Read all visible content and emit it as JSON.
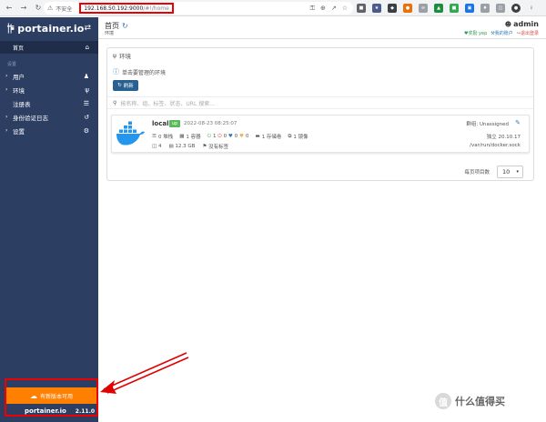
{
  "browser": {
    "security": "不安全",
    "url_host": "192.168.50.192:9000",
    "url_path": "/#!/home"
  },
  "sidebar": {
    "logo": "portainer.io",
    "home": "首页",
    "section": "设置",
    "items": [
      {
        "label": "用户",
        "icon": "users-icon"
      },
      {
        "label": "环境",
        "icon": "plug-icon"
      },
      {
        "label": "注册表",
        "icon": "database-icon"
      },
      {
        "label": "身份验证日志",
        "icon": "history-icon"
      },
      {
        "label": "设置",
        "icon": "cogs-icon"
      }
    ],
    "update_banner": "有新版本可用",
    "footer_logo": "portainer.io",
    "version": "2.11.0"
  },
  "header": {
    "title": "首页",
    "crumb": "环境",
    "user": "admin",
    "links": {
      "reward": "奖励 yep",
      "account": "我的账户",
      "logout": "退出登录"
    }
  },
  "panel": {
    "title": "环境",
    "info": "单击要管理的环境",
    "refresh": "刷新",
    "search_placeholder": "按名称、组、标签、状态、URL 搜索..."
  },
  "environment": {
    "name": "local",
    "status": "up",
    "date": "2022-08-23 08:25:07",
    "stacks": "0 堆栈",
    "containers": "1 容器",
    "stopped": "1",
    "healthy": "0",
    "running": "0",
    "unhealthy": "0",
    "volumes": "1 存储卷",
    "images": "1 镜像",
    "cpu": "4",
    "memory": "12.3 GB",
    "tags": "没有标签",
    "group": "群组: Unassigned",
    "version": "独立 20.10.17",
    "socket": "/var/run/docker.sock"
  },
  "pagination": {
    "label": "每页项目数",
    "value": "10"
  },
  "watermark": "什么值得买",
  "colors": {
    "sidebar": "#2d3e63",
    "accent_orange": "#ff7f00",
    "primary": "#286090",
    "annotation": "#e00000",
    "status_up": "#5cb85c"
  }
}
